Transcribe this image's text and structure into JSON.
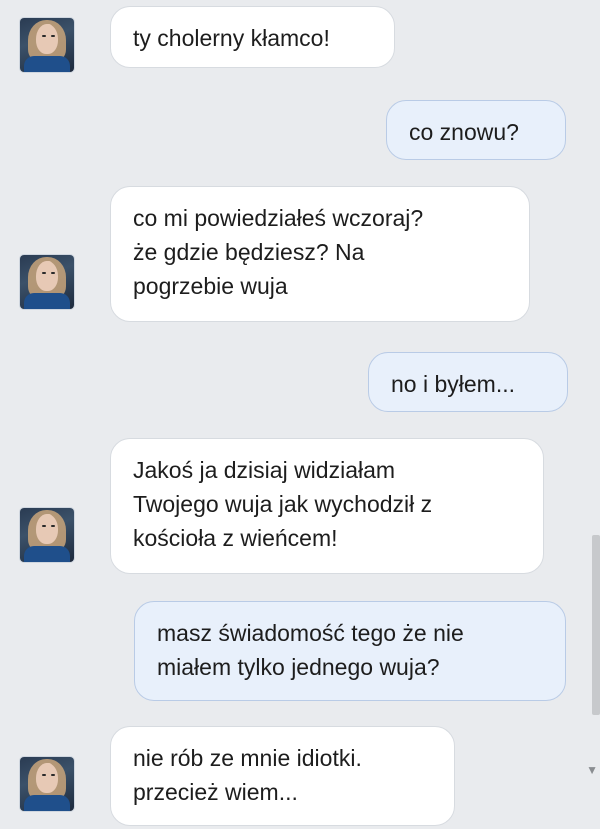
{
  "messages": [
    {
      "from": "them",
      "lines": [
        "ty cholerny kłamco!"
      ]
    },
    {
      "from": "me",
      "lines": [
        "co znowu?"
      ]
    },
    {
      "from": "them",
      "lines": [
        "co mi powiedziałeś wczoraj?",
        "że gdzie będziesz? Na",
        "pogrzebie wuja"
      ]
    },
    {
      "from": "me",
      "lines": [
        "no i byłem..."
      ]
    },
    {
      "from": "them",
      "lines": [
        "Jakoś ja dzisiaj widziałam",
        "Twojego wuja jak wychodził z",
        "kościoła z wieńcem!"
      ]
    },
    {
      "from": "me",
      "lines": [
        "masz świadomość tego że nie",
        "miałem tylko jednego wuja?"
      ]
    },
    {
      "from": "them",
      "lines": [
        "nie rób ze mnie idiotki.",
        "przecież wiem..."
      ]
    }
  ],
  "icons": {
    "avatar": "user-avatar-photo",
    "scroll": "chevron-down-icon"
  },
  "colors": {
    "background": "#e9ebee",
    "incoming": "#ffffff",
    "outgoing": "#e8f0fb",
    "outgoing_border": "#b9cbe6"
  }
}
